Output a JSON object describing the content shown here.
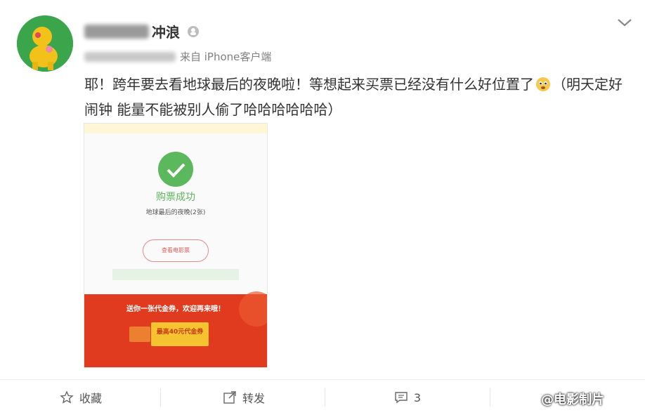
{
  "post": {
    "username_visible": "冲浪",
    "source": "来自 iPhone客户端",
    "text_part1": "耶！跨年要去看地球最后的夜晚啦！等想起来买票已经没有什么好位置了",
    "text_part2": "（明天定好闹钟 能量不能被别人偷了哈哈哈哈哈哈）"
  },
  "screenshot": {
    "success_text": "购票成功",
    "ticket_name": "地球最后的夜晚(2张)",
    "view_order": "查看电影票",
    "coupon_msg": "送你一张代金券，欢迎再来哦！",
    "coupon_title": "最高40元代金券"
  },
  "actions": {
    "favorite": "收藏",
    "repost": "转发",
    "comment_count": "3"
  },
  "watermark": "@电影制片"
}
